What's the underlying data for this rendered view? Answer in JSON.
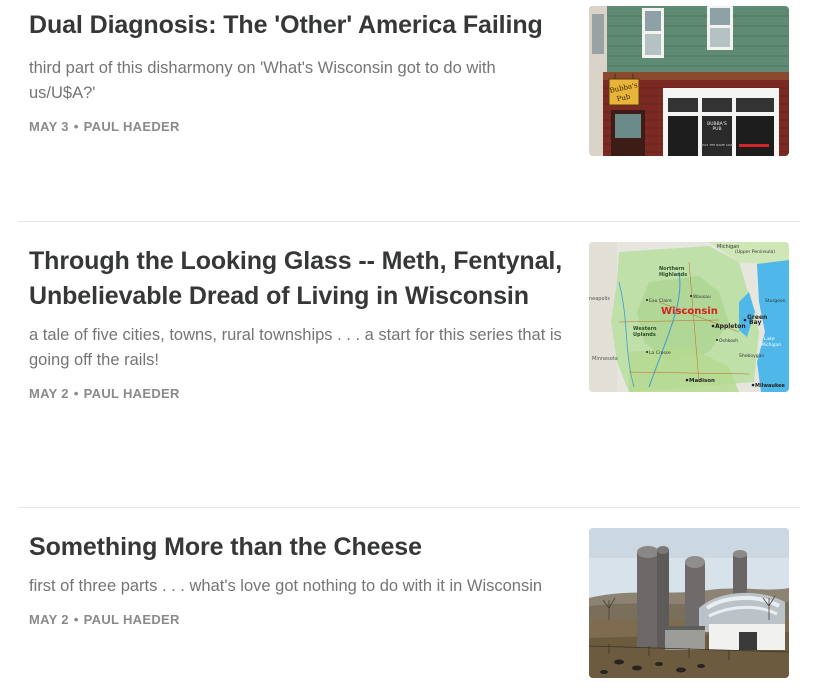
{
  "posts": [
    {
      "title": "Dual Diagnosis: The 'Other' America Failing",
      "subtitle": "third part of this disharmony on 'What's Wisconsin got to do with us/U$A?'",
      "date": "MAY 3",
      "separator": "•",
      "author": "PAUL HAEDER",
      "image": {
        "icon": "pub-storefront-photo",
        "sign_text": "Bubba's Pub",
        "window_text": "BUBBA'S PUB",
        "window_small": "PASS THE NAME SIGN",
        "colors": {
          "siding": "#5f8a74",
          "brick": "#7a2a22",
          "sign": "#e7b53a"
        }
      }
    },
    {
      "title": "Through the Looking Glass -- Meth, Fentynal, Unbelievable Dread of Living in Wisconsin",
      "subtitle": "a tale of five cities, towns, rural townships . . . a start for this series that is going off the rails!",
      "date": "MAY 2",
      "separator": "•",
      "author": "PAUL HAEDER",
      "image": {
        "icon": "wisconsin-map",
        "labels": {
          "state": "Wisconsin",
          "michigan": "Michigan",
          "upper_peninsula": "(Upper Peninsula)",
          "lake": "Lake Michigan",
          "cities": [
            "Northern Highlands",
            "Green Bay",
            "Appleton",
            "Oshkosh",
            "Wausau",
            "Madison",
            "Milwaukee",
            "Minnesota",
            "Eau Claire",
            "La Crosse",
            "Western Uplands",
            "Manitowoc",
            "Sheboygan",
            "Sturgeon Bay"
          ]
        },
        "colors": {
          "land": "#bfe0a9",
          "water": "#4fb8e8",
          "label": "#d62020"
        }
      }
    },
    {
      "title": "Something More than the Cheese",
      "subtitle": "first of three parts . . . what's love got nothing to do with it in Wisconsin",
      "date": "MAY 2",
      "separator": "•",
      "author": "PAUL HAEDER",
      "image": {
        "icon": "farm-silos-photo",
        "colors": {
          "sky": "#d8e2ea",
          "field": "#7f6c4e",
          "silo": "#6c6868"
        }
      }
    }
  ]
}
